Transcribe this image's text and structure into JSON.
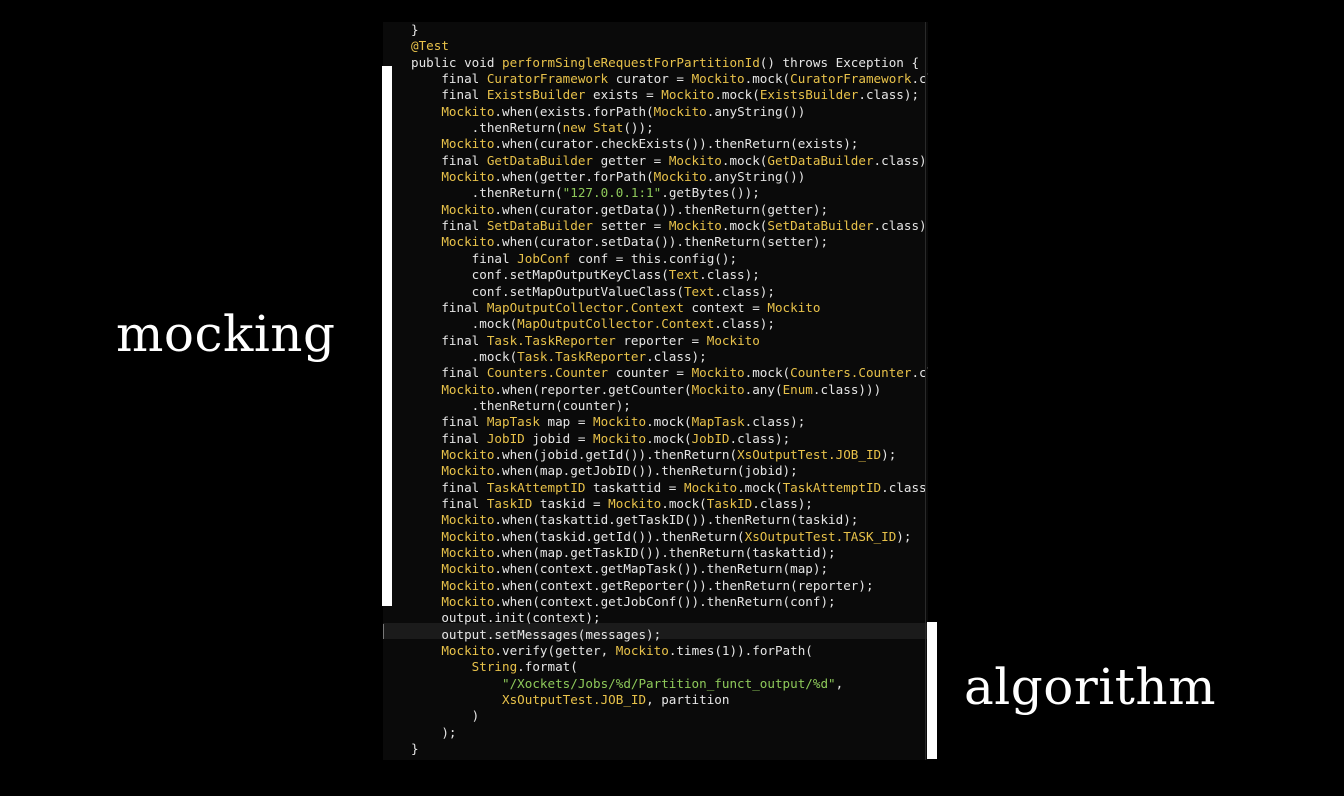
{
  "labels": {
    "mocking": "mocking",
    "algorithm": "algorithm"
  },
  "code": {
    "lines": [
      [
        [
          "w",
          "}"
        ]
      ],
      [
        [
          "y",
          "@Test"
        ]
      ],
      [
        [
          "w",
          "public void "
        ],
        [
          "y",
          "performSingleRequestForPartitionId"
        ],
        [
          "w",
          "() throws Exception {"
        ]
      ],
      [
        [
          "w",
          "    final "
        ],
        [
          "y",
          "CuratorFramework"
        ],
        [
          "w",
          " curator = "
        ],
        [
          "y",
          "Mockito"
        ],
        [
          "w",
          ".mock("
        ],
        [
          "y",
          "CuratorFramework"
        ],
        [
          "w",
          ".class);"
        ]
      ],
      [
        [
          "w",
          "    final "
        ],
        [
          "y",
          "ExistsBuilder"
        ],
        [
          "w",
          " exists = "
        ],
        [
          "y",
          "Mockito"
        ],
        [
          "w",
          ".mock("
        ],
        [
          "y",
          "ExistsBuilder"
        ],
        [
          "w",
          ".class);"
        ]
      ],
      [
        [
          "w",
          "    "
        ],
        [
          "y",
          "Mockito"
        ],
        [
          "w",
          ".when(exists.forPath("
        ],
        [
          "y",
          "Mockito"
        ],
        [
          "w",
          ".anyString())"
        ]
      ],
      [
        [
          "w",
          "        .thenReturn("
        ],
        [
          "y",
          "new Stat"
        ],
        [
          "w",
          "());"
        ]
      ],
      [
        [
          "w",
          "    "
        ],
        [
          "y",
          "Mockito"
        ],
        [
          "w",
          ".when(curator.checkExists()).thenReturn(exists);"
        ]
      ],
      [
        [
          "w",
          "    final "
        ],
        [
          "y",
          "GetDataBuilder"
        ],
        [
          "w",
          " getter = "
        ],
        [
          "y",
          "Mockito"
        ],
        [
          "w",
          ".mock("
        ],
        [
          "y",
          "GetDataBuilder"
        ],
        [
          "w",
          ".class);"
        ]
      ],
      [
        [
          "w",
          "    "
        ],
        [
          "y",
          "Mockito"
        ],
        [
          "w",
          ".when(getter.forPath("
        ],
        [
          "y",
          "Mockito"
        ],
        [
          "w",
          ".anyString())"
        ]
      ],
      [
        [
          "w",
          "        .thenReturn("
        ],
        [
          "g",
          "\"127.0.0.1:1\""
        ],
        [
          "w",
          ".getBytes());"
        ]
      ],
      [
        [
          "w",
          "    "
        ],
        [
          "y",
          "Mockito"
        ],
        [
          "w",
          ".when(curator.getData()).thenReturn(getter);"
        ]
      ],
      [
        [
          "w",
          "    final "
        ],
        [
          "y",
          "SetDataBuilder"
        ],
        [
          "w",
          " setter = "
        ],
        [
          "y",
          "Mockito"
        ],
        [
          "w",
          ".mock("
        ],
        [
          "y",
          "SetDataBuilder"
        ],
        [
          "w",
          ".class);"
        ]
      ],
      [
        [
          "w",
          "    "
        ],
        [
          "y",
          "Mockito"
        ],
        [
          "w",
          ".when(curator.setData()).thenReturn(setter);"
        ]
      ],
      [
        [
          "w",
          "        final "
        ],
        [
          "y",
          "JobConf"
        ],
        [
          "w",
          " conf = this.config();"
        ]
      ],
      [
        [
          "w",
          "        conf.setMapOutputKeyClass("
        ],
        [
          "y",
          "Text"
        ],
        [
          "w",
          ".class);"
        ]
      ],
      [
        [
          "w",
          "        conf.setMapOutputValueClass("
        ],
        [
          "y",
          "Text"
        ],
        [
          "w",
          ".class);"
        ]
      ],
      [
        [
          "w",
          "    final "
        ],
        [
          "y",
          "MapOutputCollector.Context"
        ],
        [
          "w",
          " context = "
        ],
        [
          "y",
          "Mockito"
        ]
      ],
      [
        [
          "w",
          "        .mock("
        ],
        [
          "y",
          "MapOutputCollector.Context"
        ],
        [
          "w",
          ".class);"
        ]
      ],
      [
        [
          "w",
          "    final "
        ],
        [
          "y",
          "Task.TaskReporter"
        ],
        [
          "w",
          " reporter = "
        ],
        [
          "y",
          "Mockito"
        ]
      ],
      [
        [
          "w",
          "        .mock("
        ],
        [
          "y",
          "Task.TaskReporter"
        ],
        [
          "w",
          ".class);"
        ]
      ],
      [
        [
          "w",
          "    final "
        ],
        [
          "y",
          "Counters.Counter"
        ],
        [
          "w",
          " counter = "
        ],
        [
          "y",
          "Mockito"
        ],
        [
          "w",
          ".mock("
        ],
        [
          "y",
          "Counters.Counter"
        ],
        [
          "w",
          ".class);"
        ]
      ],
      [
        [
          "w",
          "    "
        ],
        [
          "y",
          "Mockito"
        ],
        [
          "w",
          ".when(reporter.getCounter("
        ],
        [
          "y",
          "Mockito"
        ],
        [
          "w",
          ".any("
        ],
        [
          "y",
          "Enum"
        ],
        [
          "w",
          ".class)))"
        ]
      ],
      [
        [
          "w",
          "        .thenReturn(counter);"
        ]
      ],
      [
        [
          "w",
          "    final "
        ],
        [
          "y",
          "MapTask"
        ],
        [
          "w",
          " map = "
        ],
        [
          "y",
          "Mockito"
        ],
        [
          "w",
          ".mock("
        ],
        [
          "y",
          "MapTask"
        ],
        [
          "w",
          ".class);"
        ]
      ],
      [
        [
          "w",
          "    final "
        ],
        [
          "y",
          "JobID"
        ],
        [
          "w",
          " jobid = "
        ],
        [
          "y",
          "Mockito"
        ],
        [
          "w",
          ".mock("
        ],
        [
          "y",
          "JobID"
        ],
        [
          "w",
          ".class);"
        ]
      ],
      [
        [
          "w",
          "    "
        ],
        [
          "y",
          "Mockito"
        ],
        [
          "w",
          ".when(jobid.getId()).thenReturn("
        ],
        [
          "y",
          "XsOutputTest.JOB_ID"
        ],
        [
          "w",
          ");"
        ]
      ],
      [
        [
          "w",
          "    "
        ],
        [
          "y",
          "Mockito"
        ],
        [
          "w",
          ".when(map.getJobID()).thenReturn(jobid);"
        ]
      ],
      [
        [
          "w",
          "    final "
        ],
        [
          "y",
          "TaskAttemptID"
        ],
        [
          "w",
          " taskattid = "
        ],
        [
          "y",
          "Mockito"
        ],
        [
          "w",
          ".mock("
        ],
        [
          "y",
          "TaskAttemptID"
        ],
        [
          "w",
          ".class);"
        ]
      ],
      [
        [
          "w",
          "    final "
        ],
        [
          "y",
          "TaskID"
        ],
        [
          "w",
          " taskid = "
        ],
        [
          "y",
          "Mockito"
        ],
        [
          "w",
          ".mock("
        ],
        [
          "y",
          "TaskID"
        ],
        [
          "w",
          ".class);"
        ]
      ],
      [
        [
          "w",
          "    "
        ],
        [
          "y",
          "Mockito"
        ],
        [
          "w",
          ".when(taskattid.getTaskID()).thenReturn(taskid);"
        ]
      ],
      [
        [
          "w",
          "    "
        ],
        [
          "y",
          "Mockito"
        ],
        [
          "w",
          ".when(taskid.getId()).thenReturn("
        ],
        [
          "y",
          "XsOutputTest.TASK_ID"
        ],
        [
          "w",
          ");"
        ]
      ],
      [
        [
          "w",
          "    "
        ],
        [
          "y",
          "Mockito"
        ],
        [
          "w",
          ".when(map.getTaskID()).thenReturn(taskattid);"
        ]
      ],
      [
        [
          "w",
          "    "
        ],
        [
          "y",
          "Mockito"
        ],
        [
          "w",
          ".when(context.getMapTask()).thenReturn(map);"
        ]
      ],
      [
        [
          "w",
          "    "
        ],
        [
          "y",
          "Mockito"
        ],
        [
          "w",
          ".when(context.getReporter()).thenReturn(reporter);"
        ]
      ],
      [
        [
          "w",
          "    "
        ],
        [
          "y",
          "Mockito"
        ],
        [
          "w",
          ".when(context.getJobConf()).thenReturn(conf);"
        ]
      ],
      [
        [
          "w",
          "    output.init(context);"
        ]
      ],
      [
        [
          "w",
          "    output.setMessages(messages);"
        ]
      ],
      [
        [
          "w",
          "    "
        ],
        [
          "y",
          "Mockito"
        ],
        [
          "w",
          ".verify(getter, "
        ],
        [
          "y",
          "Mockito"
        ],
        [
          "w",
          ".times(1)).forPath("
        ]
      ],
      [
        [
          "w",
          "        "
        ],
        [
          "y",
          "String"
        ],
        [
          "w",
          ".format("
        ]
      ],
      [
        [
          "w",
          "            "
        ],
        [
          "g",
          "\"/Xockets/Jobs/%d/Partition_funct_output/%d\""
        ],
        [
          "w",
          ","
        ]
      ],
      [
        [
          "w",
          "            "
        ],
        [
          "y",
          "XsOutputTest.JOB_ID"
        ],
        [
          "w",
          ", partition"
        ]
      ],
      [
        [
          "w",
          "        )"
        ]
      ],
      [
        [
          "w",
          "    );"
        ]
      ],
      [
        [
          "w",
          "}"
        ]
      ]
    ]
  }
}
